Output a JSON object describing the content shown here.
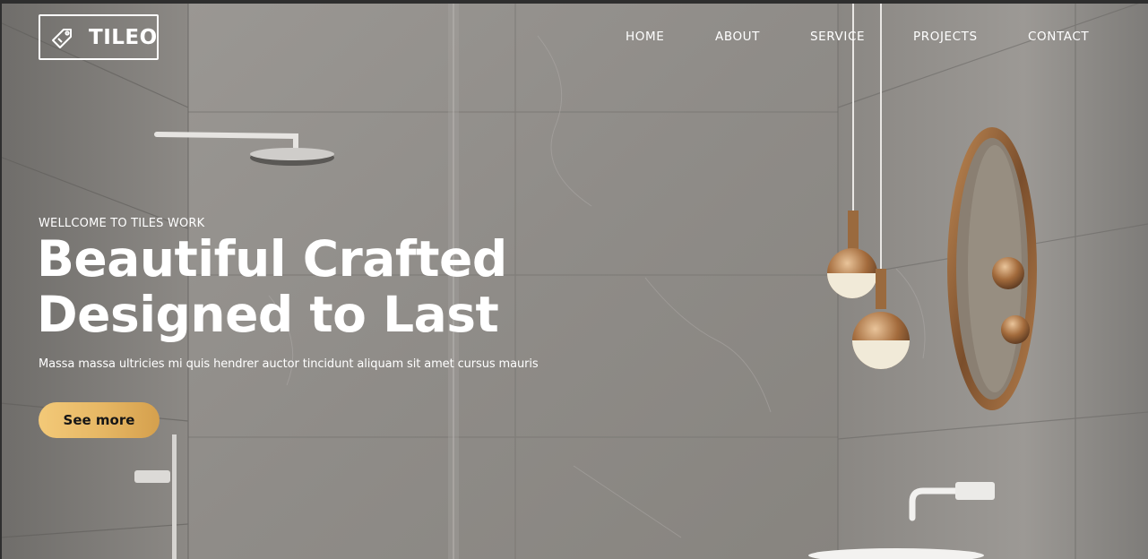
{
  "brand": {
    "name": "TILEO",
    "icon": "tile-tag-icon"
  },
  "nav": {
    "items": [
      {
        "label": "HOME"
      },
      {
        "label": "ABOUT"
      },
      {
        "label": "SERVICE"
      },
      {
        "label": "PROJECTS"
      },
      {
        "label": "CONTACT"
      }
    ]
  },
  "hero": {
    "eyebrow": "WELLCOME TO TILES WORK",
    "headline_line1": "Beautiful Crafted",
    "headline_line2": "Designed to Last",
    "subtext": "Massa massa ultricies mi quis hendrer auctor tincidunt aliquam sit amet cursus mauris",
    "cta_label": "See more",
    "background_image": "bathroom-scene-marble-tiles"
  },
  "colors": {
    "cta_gradient_start": "#f3c978",
    "cta_gradient_end": "#d5a04d",
    "text": "#ffffff",
    "cta_text": "#161616"
  }
}
